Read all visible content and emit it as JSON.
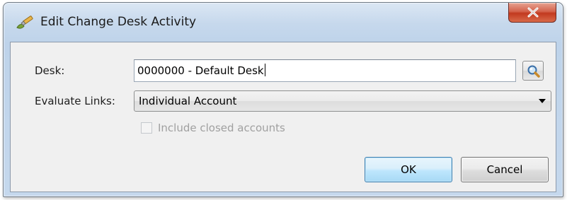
{
  "window": {
    "title": "Edit Change Desk Activity",
    "icon": "pencil-brush-icon",
    "close_icon": "close-x-icon"
  },
  "form": {
    "desk_label": "Desk:",
    "desk_value": "0000000 - Default Desk",
    "search_icon": "magnifier-icon",
    "evaluate_links_label": "Evaluate Links:",
    "evaluate_links_value": "Individual Account",
    "include_closed_label": "Include closed accounts",
    "include_closed_checked": false,
    "include_closed_enabled": false
  },
  "buttons": {
    "ok_label": "OK",
    "cancel_label": "Cancel"
  },
  "colors": {
    "title_bar": "#c6d8ec",
    "close_button": "#c2391f",
    "ok_button": "#bee6fd",
    "disabled_text": "#a0a0a0"
  }
}
